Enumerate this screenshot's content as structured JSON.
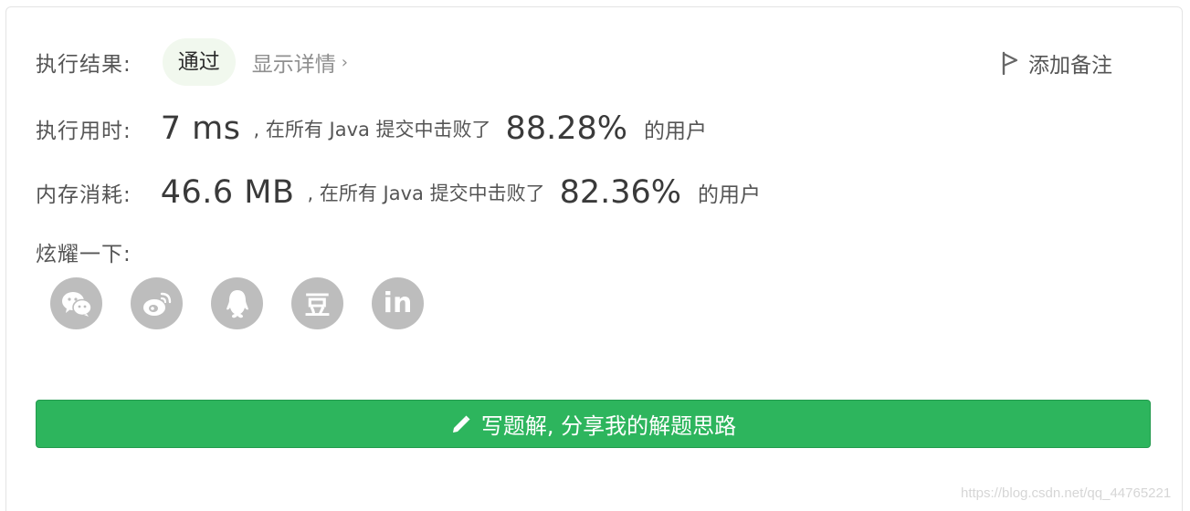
{
  "result": {
    "label": "执行结果:",
    "status": "通过",
    "details_link": "显示详情",
    "add_note": "添加备注"
  },
  "runtime": {
    "label": "执行用时:",
    "value": "7 ms",
    "middle_text": ", 在所有 Java 提交中击败了",
    "percent": "88.28%",
    "tail": "的用户"
  },
  "memory": {
    "label": "内存消耗:",
    "value": "46.6 MB",
    "middle_text": ", 在所有 Java 提交中击败了",
    "percent": "82.36%",
    "tail": "的用户"
  },
  "share": {
    "label": "炫耀一下:",
    "buttons": [
      {
        "icon": "wechat-icon",
        "glyph": ""
      },
      {
        "icon": "weibo-icon",
        "glyph": ""
      },
      {
        "icon": "qq-icon",
        "glyph": ""
      },
      {
        "icon": "douban-icon",
        "glyph": "豆"
      },
      {
        "icon": "linkedin-icon",
        "glyph": "in"
      }
    ]
  },
  "cta": {
    "label": "写题解, 分享我的解题思路",
    "icon": "pencil-icon"
  },
  "watermark": "https://blog.csdn.net/qq_44765221",
  "colors": {
    "accent_green": "#2db55d",
    "badge_bg": "#f1f8ee",
    "share_icon_bg": "#bdbdbd"
  }
}
